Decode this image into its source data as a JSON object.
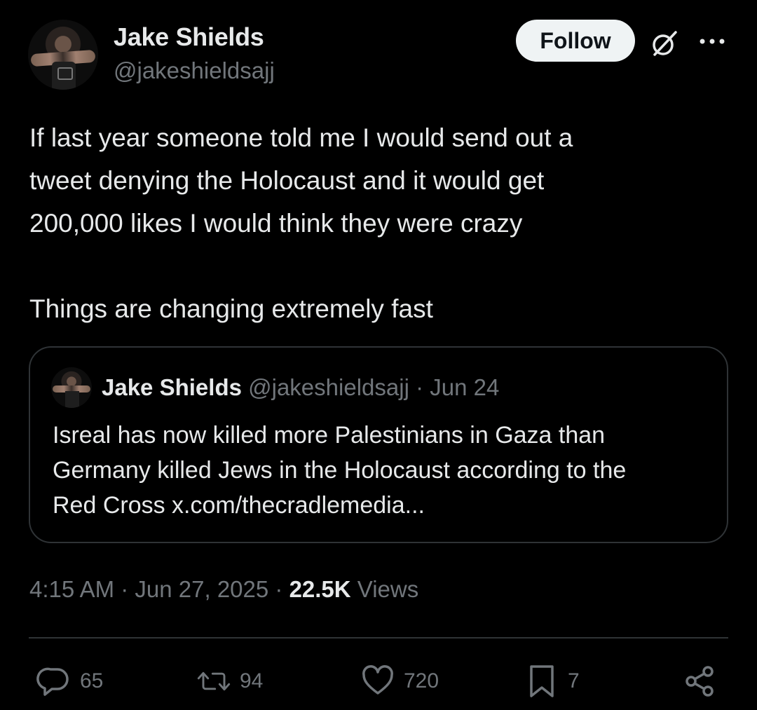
{
  "author": {
    "name": "Jake Shields",
    "handle": "@jakeshieldsajj"
  },
  "header": {
    "follow_label": "Follow",
    "grok_icon": "grok-icon",
    "more_icon": "more-horizontal-icon"
  },
  "tweet": {
    "lines": [
      "If last year someone told me I would send out a",
      "tweet denying the Holocaust and it would get",
      "200,000 likes I would think they were crazy",
      "Things are changing extremely fast"
    ]
  },
  "quote": {
    "name": "Jake Shields",
    "meta": "@jakeshieldsajj · Jun 24",
    "lines": [
      "Isreal has now killed more Palestinians in Gaza than",
      "Germany killed Jews in the Holocaust according to the",
      "Red Cross x.com/thecradlemedia..."
    ]
  },
  "meta": {
    "time": "4:15 AM · Jun 27, 2025 · ",
    "views_count": "22.5K",
    "views_label": " Views"
  },
  "actions": {
    "replies": "65",
    "reposts": "94",
    "likes": "720",
    "bookmarks": "7"
  },
  "colors": {
    "background": "#000000",
    "text": "#e7e9ea",
    "muted": "#71767b",
    "border": "#2f3336",
    "follow_bg": "#eff3f4"
  }
}
